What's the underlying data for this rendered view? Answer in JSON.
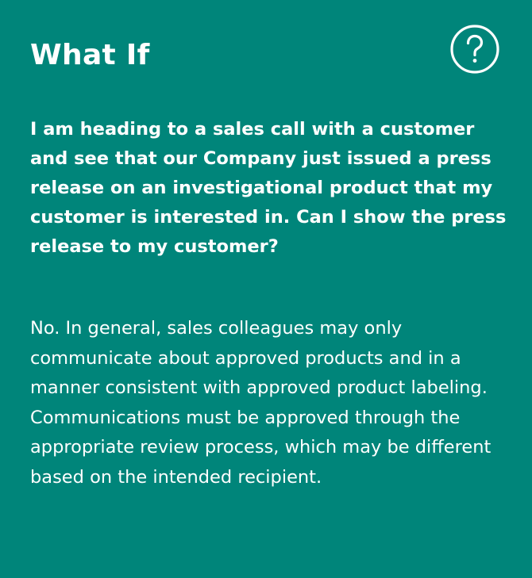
{
  "card": {
    "title": "What If",
    "help_icon": "question-circle-icon",
    "question": "I am heading to a sales call with a customer and see that our Company just issued a press release on an investigational product that my customer is interested in. Can I show the press release to my customer?",
    "answer": "No. In general, sales colleagues may only communicate about approved products and in a manner consistent with approved product labeling. Communications must be approved through the appropriate review process, which may be different based on the intended recipient."
  },
  "colors": {
    "background": "#00857a",
    "text": "#ffffff"
  }
}
